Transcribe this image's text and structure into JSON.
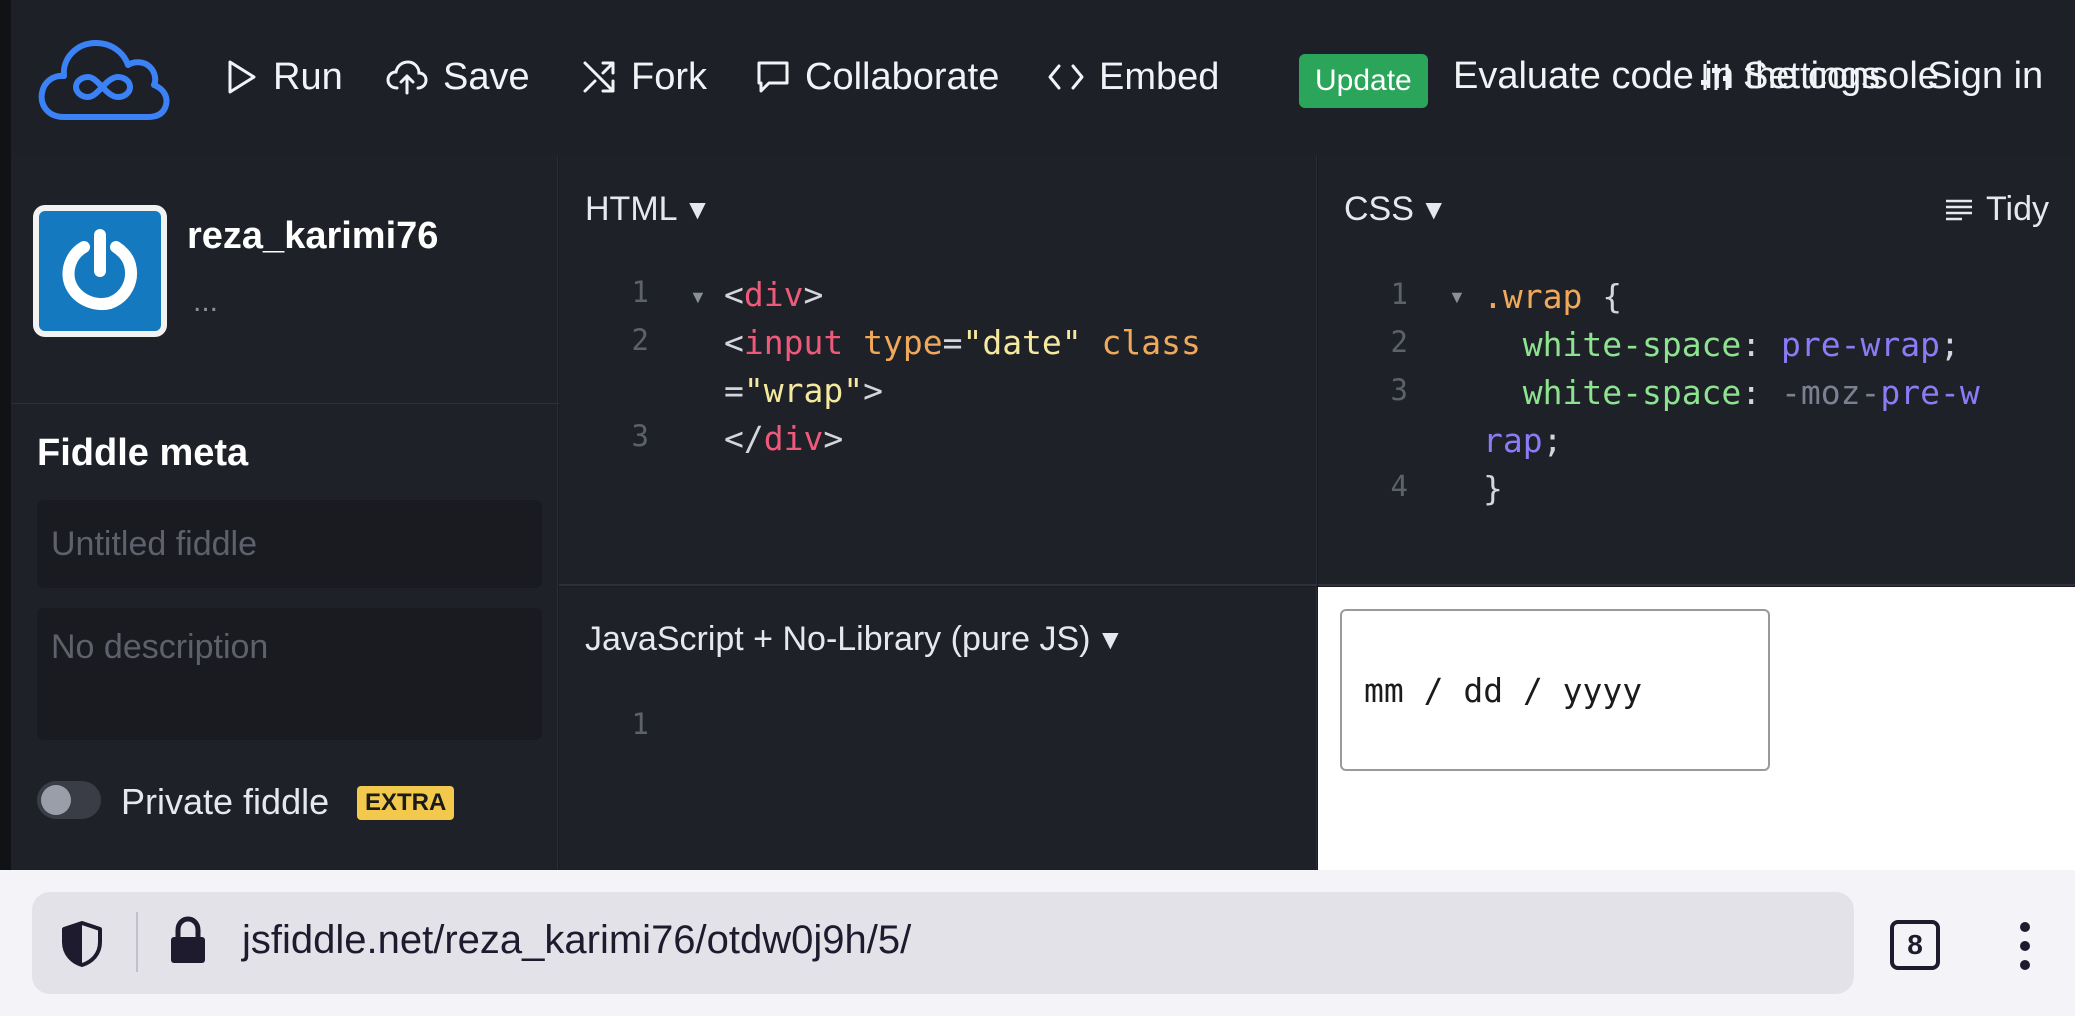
{
  "toolbar": {
    "run_label": "Run",
    "save_label": "Save",
    "fork_label": "Fork",
    "collaborate_label": "Collaborate",
    "embed_label": "Embed",
    "update_badge": "Update",
    "evaluate_text": "Evaluate code in the console",
    "settings_label": "Settings",
    "signin_label": "Sign in"
  },
  "sidebar": {
    "username": "reza_karimi76",
    "user_more": "...",
    "meta_title": "Fiddle meta",
    "title_placeholder": "Untitled fiddle",
    "description_placeholder": "No description",
    "private_label": "Private fiddle",
    "extra_badge": "EXTRA",
    "private_enabled": false
  },
  "html_panel": {
    "title": "HTML",
    "line_numbers": [
      "1",
      "2",
      "3"
    ]
  },
  "css_panel": {
    "title": "CSS",
    "tidy_label": "Tidy",
    "line_numbers": [
      "1",
      "2",
      "3",
      "4"
    ]
  },
  "js_panel": {
    "title": "JavaScript + No-Library (pure JS)",
    "line_numbers": [
      "1"
    ]
  },
  "result": {
    "date_input_display": "mm / dd / yyyy"
  },
  "browser": {
    "url": "jsfiddle.net/reza_karimi76/otdw0j9h/5/",
    "tab_count": "8"
  },
  "icons": {
    "logo": "jsfiddle-cloud-logo",
    "run": "play-icon",
    "save": "cloud-upload-icon",
    "fork": "shuffle-icon",
    "collaborate": "chat-bubble-icon",
    "embed": "code-brackets-icon",
    "settings": "sliders-icon",
    "tidy": "align-lines-icon",
    "shield": "shield-icon",
    "lock": "lock-icon",
    "menu": "kebab-menu-icon"
  },
  "colors": {
    "accent_blue": "#3b82f6",
    "update_green": "#2aa55a",
    "extra_yellow": "#f2c94c",
    "html_tag": "#f05a7a",
    "css_property": "#8de38f",
    "css_value": "#8b7cf6"
  }
}
